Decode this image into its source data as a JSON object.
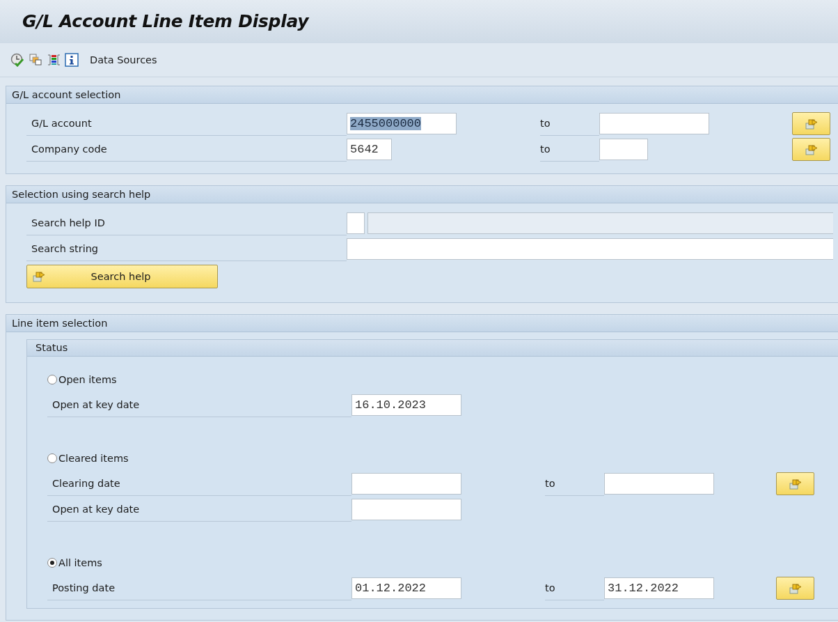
{
  "title": "G/L Account Line Item Display",
  "toolbar": {
    "label": "Data Sources"
  },
  "sections": [
    {
      "title": "G/L account selection",
      "rows": [
        {
          "kind": "range",
          "label": "G/L account",
          "value": "2455000000",
          "selected": true,
          "to_label": "to"
        },
        {
          "kind": "range",
          "label": "Company code",
          "value": "5642",
          "selected": false,
          "to_label": "to"
        }
      ]
    },
    {
      "title": "Selection using search help",
      "rows": [
        {
          "kind": "search_id",
          "label": "Search help ID"
        },
        {
          "kind": "text",
          "label": "Search string"
        },
        {
          "kind": "button",
          "label": "Search help"
        }
      ]
    },
    {
      "title": "Line item selection",
      "groups": [
        {
          "title": "Status",
          "rows": [
            {
              "kind": "radio",
              "label": "Open items",
              "selected": false
            },
            {
              "kind": "field",
              "label": "Open at key date",
              "value": "16.10.2023",
              "selected": false
            },
            {
              "kind": "radio",
              "label": "Cleared items",
              "selected": false
            },
            {
              "kind": "range",
              "label": "Clearing date",
              "to_label": "to"
            },
            {
              "kind": "field",
              "label": "Open at key date"
            },
            {
              "kind": "radio",
              "label": "All items",
              "selected": true
            },
            {
              "kind": "range",
              "label": "Posting date",
              "value": "01.12.2022",
              "selected": false,
              "to_label": "to",
              "to_value": "31.12.2022"
            }
          ]
        }
      ]
    }
  ]
}
